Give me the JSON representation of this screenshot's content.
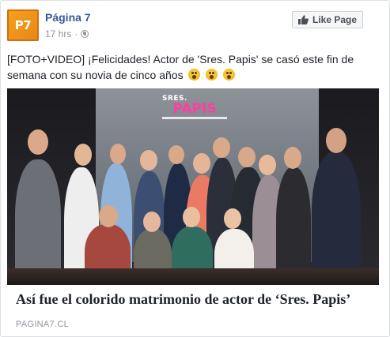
{
  "header": {
    "logo_text": "P7",
    "page_name": "Página 7",
    "timestamp": "17 hrs",
    "separator": "·",
    "privacy_icon": "globe-icon",
    "like_button_label": "Like Page",
    "like_icon": "thumbs-up-icon"
  },
  "post": {
    "text": "[FOTO+VIDEO] ¡Felicidades! Actor de 'Sres. Papis' se casó este fin de semana con su novia de cinco años",
    "emojis": [
      "astonished-face-icon",
      "astonished-face-icon",
      "astonished-face-icon"
    ]
  },
  "image": {
    "backdrop_small": "SRES.",
    "backdrop_big": "PAPIS"
  },
  "link_preview": {
    "title": "Así fue el colorido matrimonio de actor de ‘Sres. Papis’",
    "domain": "PAGINA7.CL"
  },
  "colors": {
    "link_blue": "#365899",
    "meta_gray": "#90949c",
    "logo_orange": "#f29a1c",
    "brand_pink": "#ff3ea0"
  }
}
